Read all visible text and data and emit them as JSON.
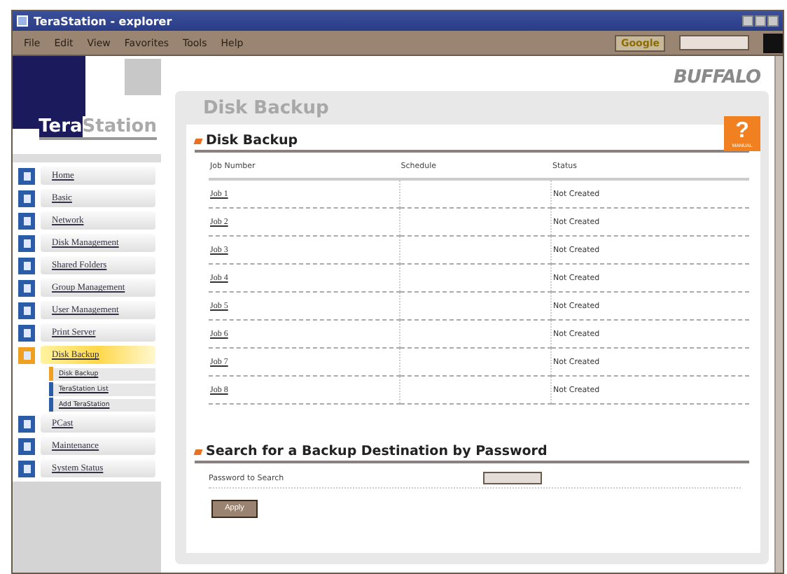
{
  "window": {
    "title": "TeraStation - explorer"
  },
  "menu_bar": [
    "File",
    "Edit",
    "View",
    "Favorites",
    "Tools",
    "Help"
  ],
  "toolbar": {
    "search_label": "Google"
  },
  "logo": {
    "part1": "Tera",
    "part2": "Station"
  },
  "brand": "BUFFALO",
  "manual_button": {
    "symbol": "?",
    "label": "MANUAL"
  },
  "sidebar": {
    "items": [
      {
        "label": "Home",
        "selected": false
      },
      {
        "label": "Basic",
        "selected": false
      },
      {
        "label": "Network",
        "selected": false
      },
      {
        "label": "Disk Management",
        "selected": false
      },
      {
        "label": "Shared Folders",
        "selected": false
      },
      {
        "label": "Group Management",
        "selected": false
      },
      {
        "label": "User Management",
        "selected": false
      },
      {
        "label": "Print Server",
        "selected": false
      },
      {
        "label": "Disk Backup",
        "selected": true,
        "children": [
          {
            "label": "Disk Backup",
            "selected": true
          },
          {
            "label": "TeraStation List",
            "selected": false
          },
          {
            "label": "Add TeraStation",
            "selected": false
          }
        ]
      },
      {
        "label": "PCast",
        "selected": false
      },
      {
        "label": "Maintenance",
        "selected": false
      },
      {
        "label": "System Status",
        "selected": false
      }
    ]
  },
  "page_title": "Disk Backup",
  "backup_section": {
    "heading": "Disk Backup",
    "columns": [
      "Job Number",
      "Schedule",
      "Status"
    ],
    "rows": [
      {
        "job": "Job 1",
        "status": "Not Created"
      },
      {
        "job": "Job 2",
        "status": "Not Created"
      },
      {
        "job": "Job 3",
        "status": "Not Created"
      },
      {
        "job": "Job 4",
        "status": "Not Created"
      },
      {
        "job": "Job 5",
        "status": "Not Created"
      },
      {
        "job": "Job 6",
        "status": "Not Created"
      },
      {
        "job": "Job 7",
        "status": "Not Created"
      },
      {
        "job": "Job 8",
        "status": "Not Created"
      }
    ]
  },
  "search_section": {
    "heading": "Search for a Backup Destination by Password",
    "field_label": "Password to Search",
    "button": "Apply"
  }
}
